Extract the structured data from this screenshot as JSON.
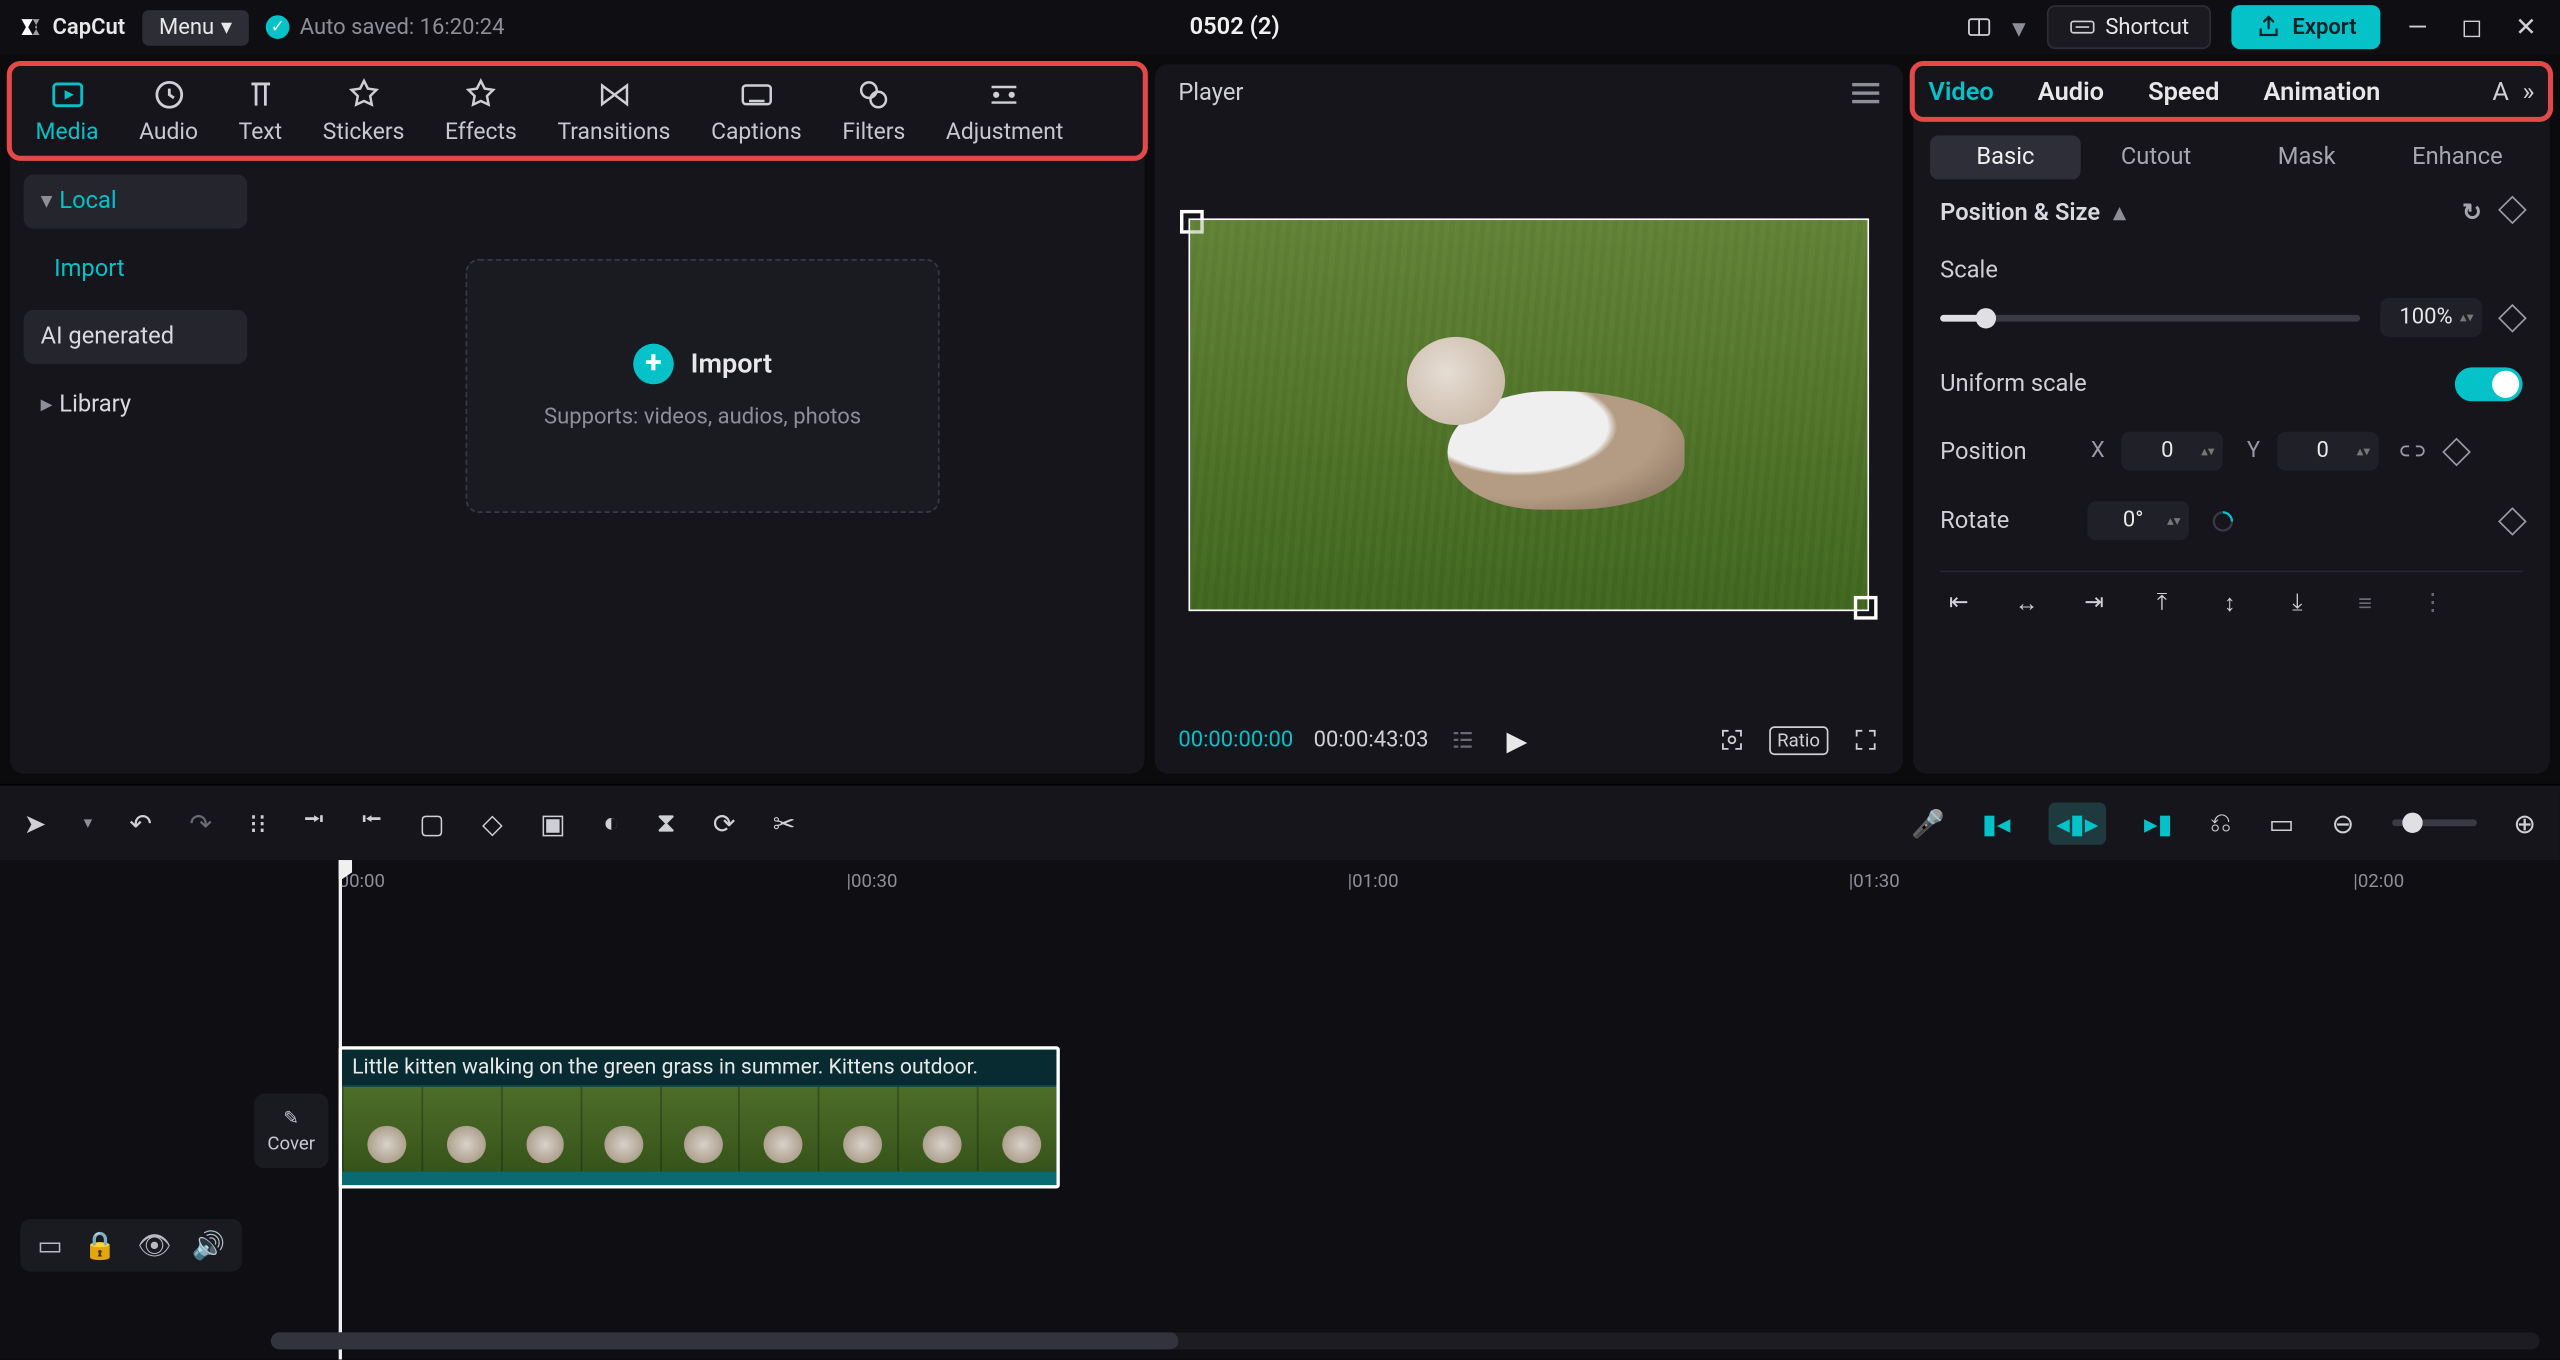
{
  "titlebar": {
    "app_name": "CapCut",
    "menu_label": "Menu",
    "autosave": "Auto saved: 16:20:24",
    "project_title": "0502 (2)",
    "shortcut_label": "Shortcut",
    "export_label": "Export"
  },
  "tool_tabs": [
    "Media",
    "Audio",
    "Text",
    "Stickers",
    "Effects",
    "Transitions",
    "Captions",
    "Filters",
    "Adjustment"
  ],
  "tool_tabs_active": 0,
  "sidebar": {
    "local": "Local",
    "import": "Import",
    "ai": "AI generated",
    "library": "Library"
  },
  "dropzone": {
    "title": "Import",
    "subtitle": "Supports: videos, audios, photos"
  },
  "player": {
    "title": "Player",
    "current": "00:00:00:00",
    "total": "00:00:43:03",
    "ratio": "Ratio"
  },
  "inspector": {
    "tabs": [
      "Video",
      "Audio",
      "Speed",
      "Animation"
    ],
    "tabs_active": 0,
    "overflow_letter": "A",
    "subtabs": [
      "Basic",
      "Cutout",
      "Mask",
      "Enhance"
    ],
    "subtabs_active": 0,
    "section_title": "Position & Size",
    "scale_label": "Scale",
    "scale_value": "100%",
    "uniform_label": "Uniform scale",
    "position_label": "Position",
    "pos_x_label": "X",
    "pos_x_value": "0",
    "pos_y_label": "Y",
    "pos_y_value": "0",
    "rotate_label": "Rotate",
    "rotate_value": "0°"
  },
  "timeline": {
    "ticks": [
      "00:00",
      "|00:30",
      "|01:00",
      "|01:30",
      "|02:00"
    ],
    "cover_label": "Cover",
    "clip_title": "Little kitten walking on the green grass in summer. Kittens outdoor."
  }
}
